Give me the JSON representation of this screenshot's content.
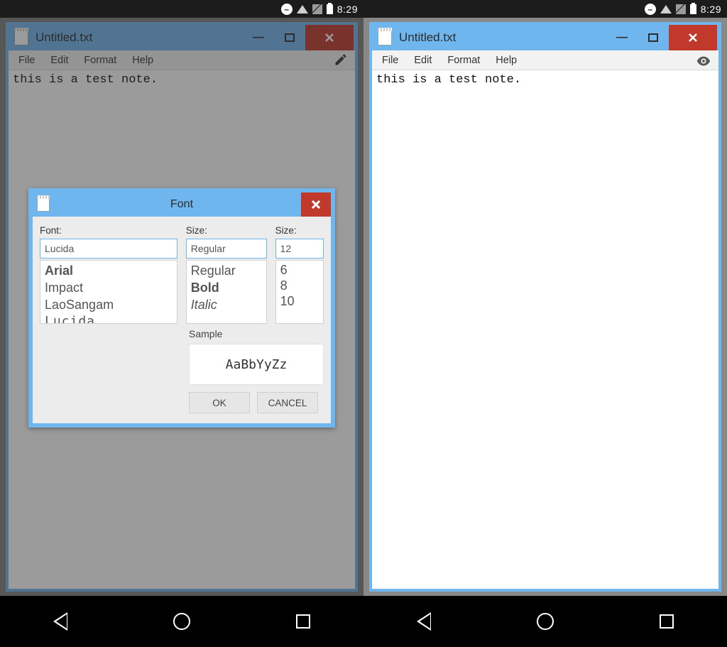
{
  "status": {
    "time": "8:29"
  },
  "window": {
    "title": "Untitled.txt",
    "menus": {
      "file": "File",
      "edit": "Edit",
      "format": "Format",
      "help": "Help"
    },
    "content": "this is a test note."
  },
  "dialog": {
    "title": "Font",
    "labels": {
      "font": "Font:",
      "style": "Size:",
      "size": "Size:",
      "sample": "Sample"
    },
    "inputs": {
      "font": "Lucida",
      "style": "Regular",
      "size": "12"
    },
    "fonts": {
      "f1": "Arial",
      "f2": "Impact",
      "f3": "LaoSangam",
      "f4": "Lucida"
    },
    "styles": {
      "s1": "Regular",
      "s2": "Bold",
      "s3": "Italic"
    },
    "sizes": {
      "z1": "6",
      "z2": "8",
      "z3": "10"
    },
    "sample_text": "AaBbYyZz",
    "buttons": {
      "ok": "OK",
      "cancel": "CANCEL"
    }
  }
}
